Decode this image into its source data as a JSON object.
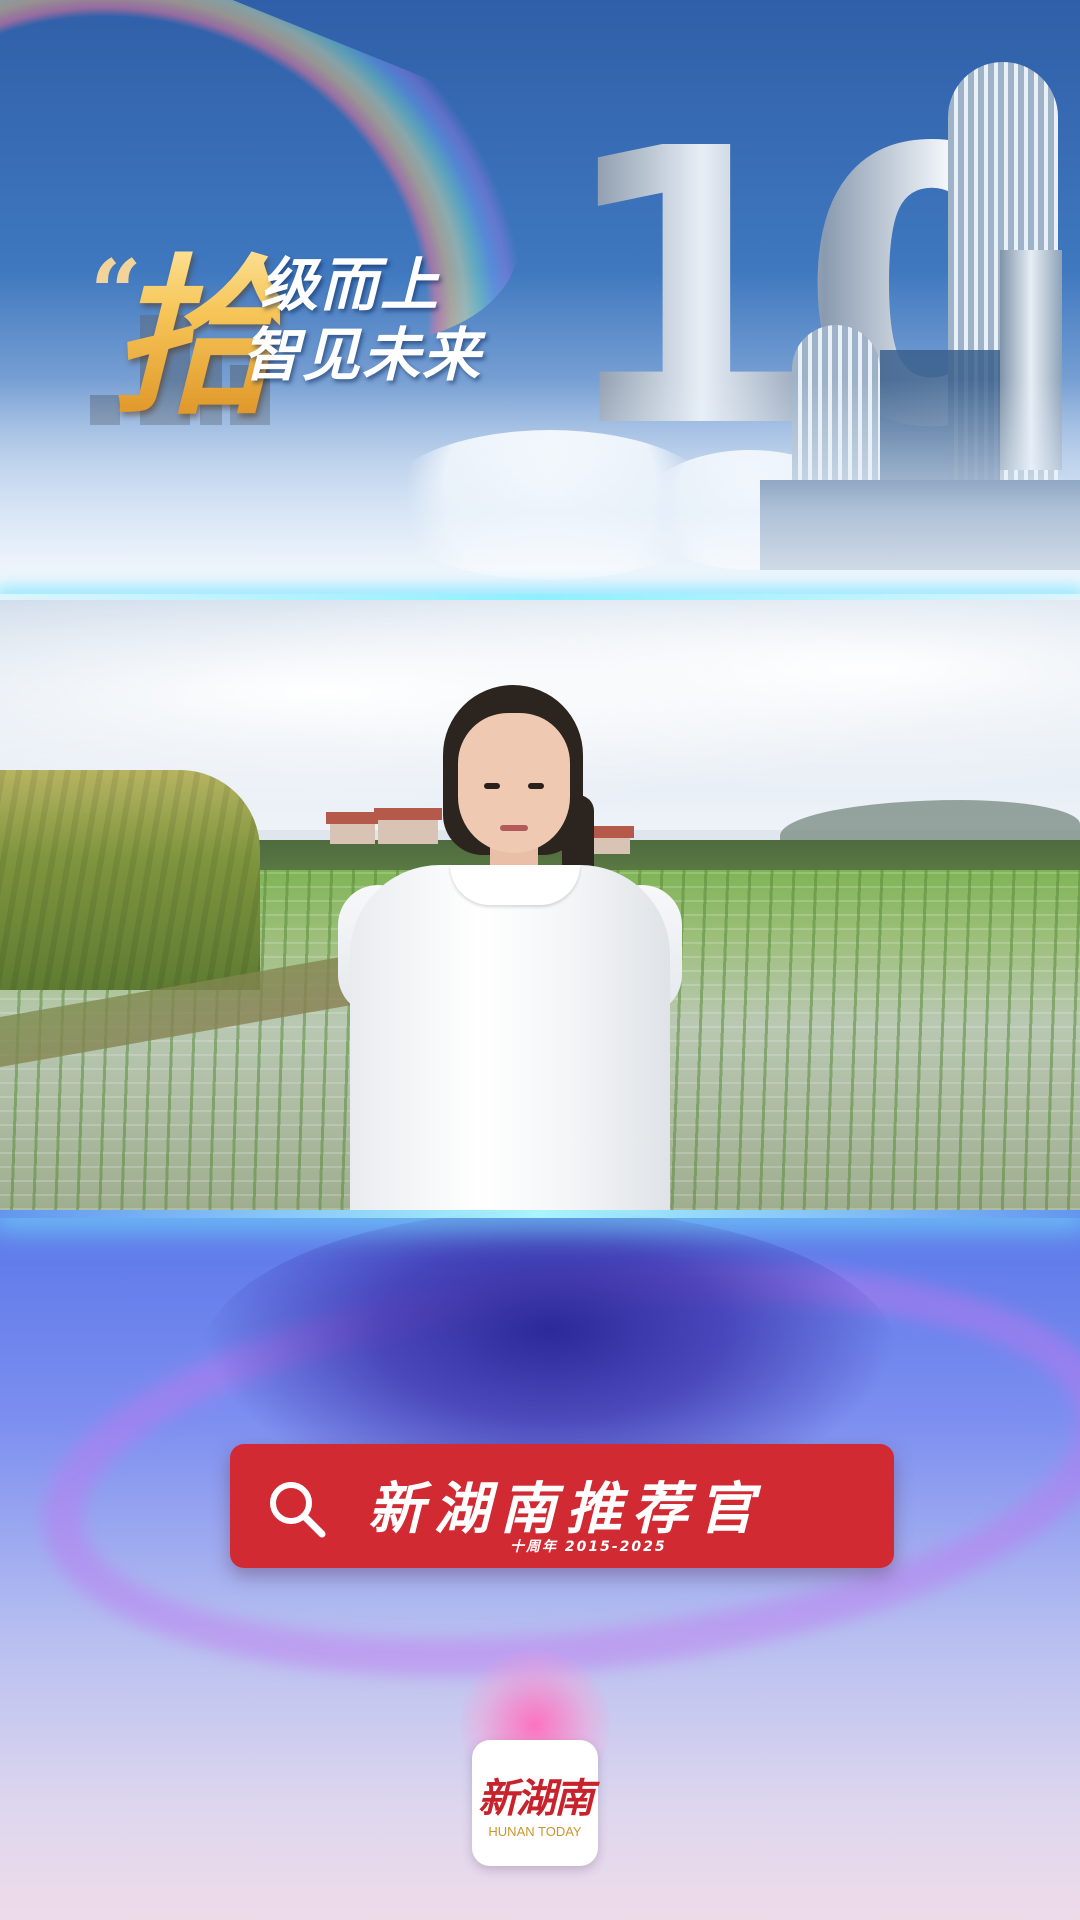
{
  "banner": {
    "slogan_big": "拾",
    "slogan_line1": "级而上",
    "slogan_line2": "智见未来",
    "anniversary_number": "10"
  },
  "search_bar": {
    "title": "新湖南推荐官",
    "subtitle": "十周年  2015-2025",
    "icon": "search-icon"
  },
  "app_logo": {
    "name_cn": "新湖南",
    "name_en": "HUNAN TODAY"
  },
  "colors": {
    "brand_red": "#d12a33",
    "logo_gold": "#c9962e",
    "slogan_gold": "#f4b84a"
  }
}
